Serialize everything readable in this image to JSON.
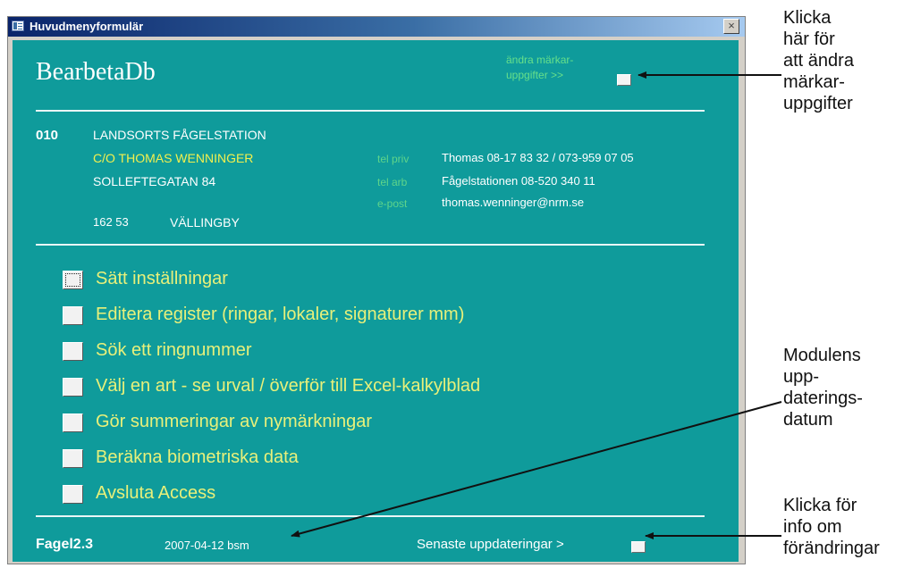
{
  "window": {
    "title": "Huvudmenyformulär",
    "close_glyph": "×"
  },
  "header": {
    "app_title": "BearbetaDb",
    "edit_marker_label_line1": "ändra märkar-",
    "edit_marker_label_line2": "uppgifter   >>"
  },
  "ringer": {
    "number": "010",
    "name": "LANDSORTS FÅGELSTATION",
    "co": "C/O  THOMAS WENNINGER",
    "street": "SOLLEFTEGATAN 84",
    "postcode": "162 53",
    "city": "VÄLLINGBY"
  },
  "contact": {
    "tel_priv_label": "tel priv",
    "tel_priv_value": "Thomas 08-17 83 32 / 073-959 07 05",
    "tel_arb_label": "tel arb",
    "tel_arb_value": "Fågelstationen 08-520 340 11",
    "email_label": "e-post",
    "email_value": "thomas.wenninger@nrm.se"
  },
  "menu": {
    "items": [
      {
        "label": "Sätt inställningar"
      },
      {
        "label": "Editera register (ringar, lokaler, signaturer mm)"
      },
      {
        "label": "Sök ett ringnummer"
      },
      {
        "label": "Välj en art  -  se urval / överför till Excel-kalkylblad"
      },
      {
        "label": "Gör summeringar av nymärkningar"
      },
      {
        "label": "Beräkna biometriska data"
      },
      {
        "label": "Avsluta Access"
      }
    ]
  },
  "footer": {
    "version": "Fagel2.3",
    "updated": "2007-04-12 bsm",
    "latest_updates": "Senaste uppdateringar >"
  },
  "annotations": {
    "edit_note": [
      "Klicka",
      "här för",
      "att ändra",
      "märkar-",
      "uppgifter"
    ],
    "date_note": [
      "Modulens",
      "upp-",
      "daterings-",
      "datum"
    ],
    "info_note": [
      "Klicka för",
      "info om",
      "förändringar"
    ]
  },
  "colors": {
    "form_bg": "#0f9b9b",
    "menu_text": "#e8f07a",
    "label_green": "#66e08a",
    "address_yellow": "#f2f04e"
  }
}
